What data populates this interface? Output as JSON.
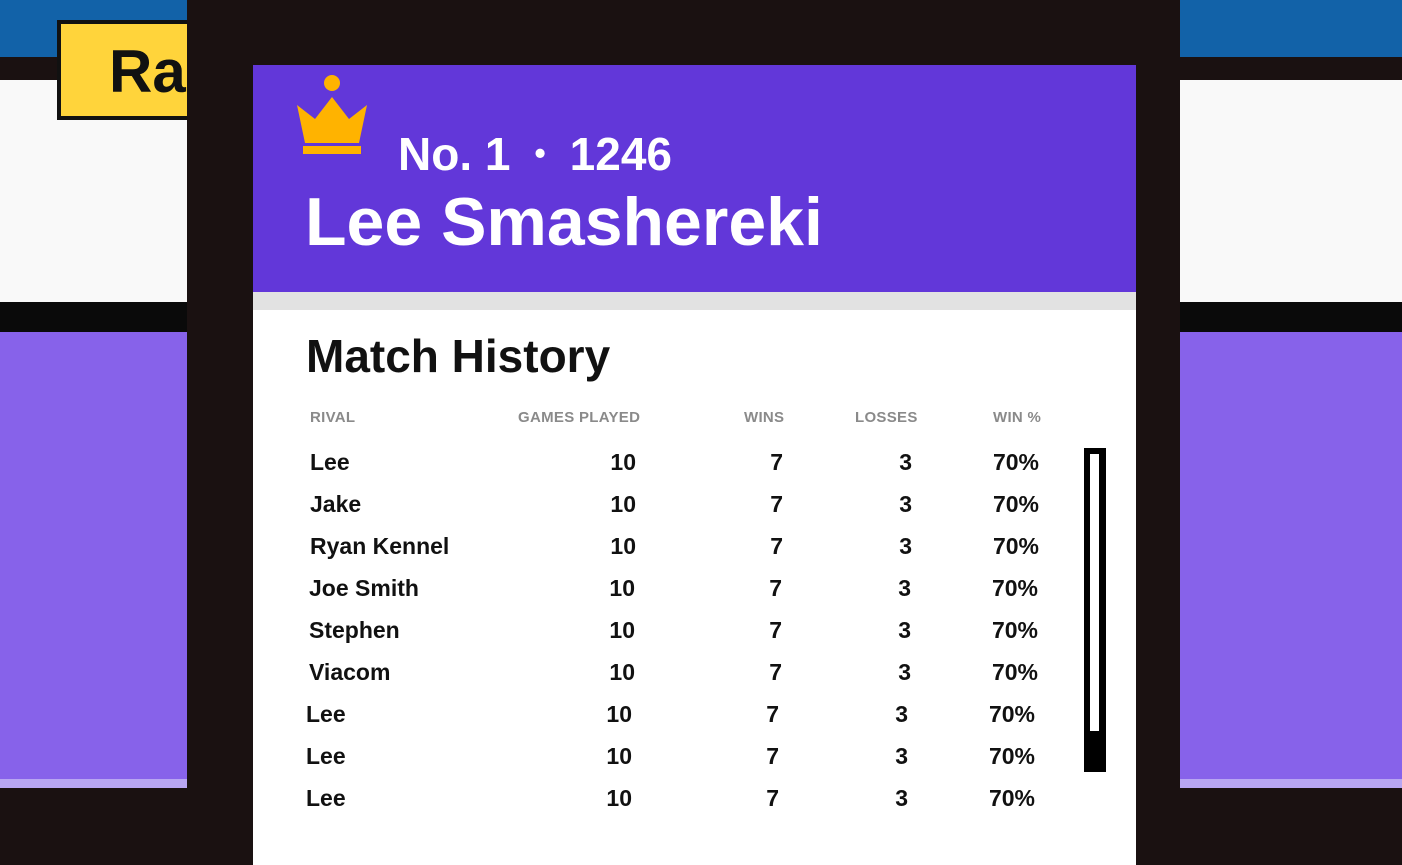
{
  "background": {
    "badge_text": "Ra"
  },
  "modal": {
    "rank_label": "No. 1",
    "separator": "•",
    "rating": "1246",
    "player_name": "Lee Smashereki",
    "crown_icon": "crown-icon",
    "section_title": "Match History",
    "columns": {
      "rival": "RIVAL",
      "games_played": "GAMES PLAYED",
      "wins": "WINS",
      "losses": "LOSSES",
      "win_pct": "WIN %"
    },
    "rows": [
      {
        "rival": "Lee",
        "games_played": "10",
        "wins": "7",
        "losses": "3",
        "win_pct": "70%"
      },
      {
        "rival": "Jake",
        "games_played": "10",
        "wins": "7",
        "losses": "3",
        "win_pct": "70%"
      },
      {
        "rival": "Ryan Kennel",
        "games_played": "10",
        "wins": "7",
        "losses": "3",
        "win_pct": "70%"
      },
      {
        "rival": "Joe Smith",
        "games_played": "10",
        "wins": "7",
        "losses": "3",
        "win_pct": "70%"
      },
      {
        "rival": "Stephen",
        "games_played": "10",
        "wins": "7",
        "losses": "3",
        "win_pct": "70%"
      },
      {
        "rival": "Viacom",
        "games_played": "10",
        "wins": "7",
        "losses": "3",
        "win_pct": "70%"
      },
      {
        "rival": "Lee",
        "games_played": "10",
        "wins": "7",
        "losses": "3",
        "win_pct": "70%"
      },
      {
        "rival": "Lee",
        "games_played": "10",
        "wins": "7",
        "losses": "3",
        "win_pct": "70%"
      },
      {
        "rival": "Lee",
        "games_played": "10",
        "wins": "7",
        "losses": "3",
        "win_pct": "70%"
      }
    ]
  },
  "colors": {
    "header_purple": "#6237d9",
    "crown_gold": "#ffb300",
    "background_blue": "#1262a8",
    "background_purple": "#8762ea",
    "badge_yellow": "#ffd43b"
  }
}
